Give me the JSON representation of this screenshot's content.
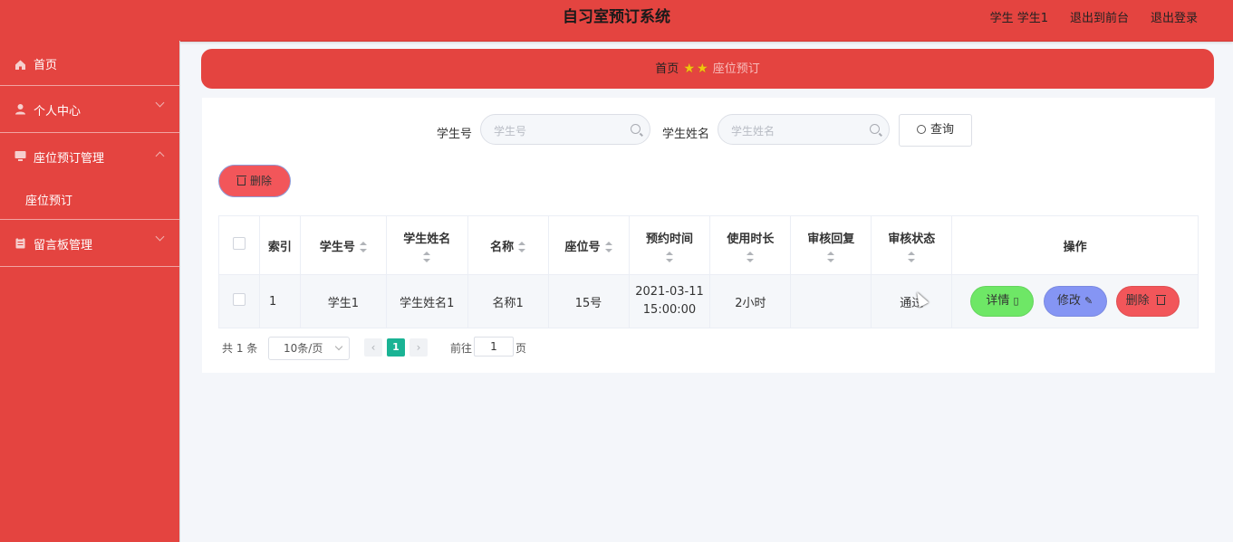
{
  "header": {
    "title": "自习室预订系统",
    "user_label": "学生 学生1",
    "to_front_label": "退出到前台",
    "logout_label": "退出登录"
  },
  "sidebar": {
    "items": [
      {
        "label": "首页",
        "icon": "home-icon"
      },
      {
        "label": "个人中心",
        "icon": "user-icon"
      },
      {
        "label": "座位预订管理",
        "icon": "monitor-icon",
        "expanded": true,
        "children": [
          {
            "label": "座位预订"
          }
        ]
      },
      {
        "label": "留言板管理",
        "icon": "clipboard-icon"
      }
    ]
  },
  "breadcrumb": {
    "home": "首页",
    "current": "座位预订"
  },
  "search": {
    "student_no_label": "学生号",
    "student_no_placeholder": "学生号",
    "student_name_label": "学生姓名",
    "student_name_placeholder": "学生姓名",
    "query_label": "查询"
  },
  "actions": {
    "delete_label": "删除"
  },
  "table": {
    "headers": [
      "索引",
      "学生号",
      "学生姓名",
      "名称",
      "座位号",
      "预约时间",
      "使用时长",
      "审核回复",
      "审核状态",
      "操作"
    ],
    "rows": [
      {
        "index": "1",
        "student_no": "学生1",
        "student_name": "学生姓名1",
        "name": "名称1",
        "seat_no": "15号",
        "reserve_date": "2021-03-11",
        "reserve_time": "15:00:00",
        "duration": "2小时",
        "reply": "",
        "status": "通过",
        "detail_label": "详情",
        "edit_label": "修改",
        "delete_label": "删除"
      }
    ]
  },
  "pagination": {
    "total": "共 1 条",
    "page_size": "10条/页",
    "current_page": "1",
    "goto_label": "前往",
    "goto_value": "1",
    "page_unit": "页"
  },
  "colors": {
    "primary_red": "#e44440",
    "detail_green": "#6ee766",
    "edit_blue": "#8595f4",
    "delete_red": "#f2565a",
    "pager_active": "#1ab394"
  }
}
